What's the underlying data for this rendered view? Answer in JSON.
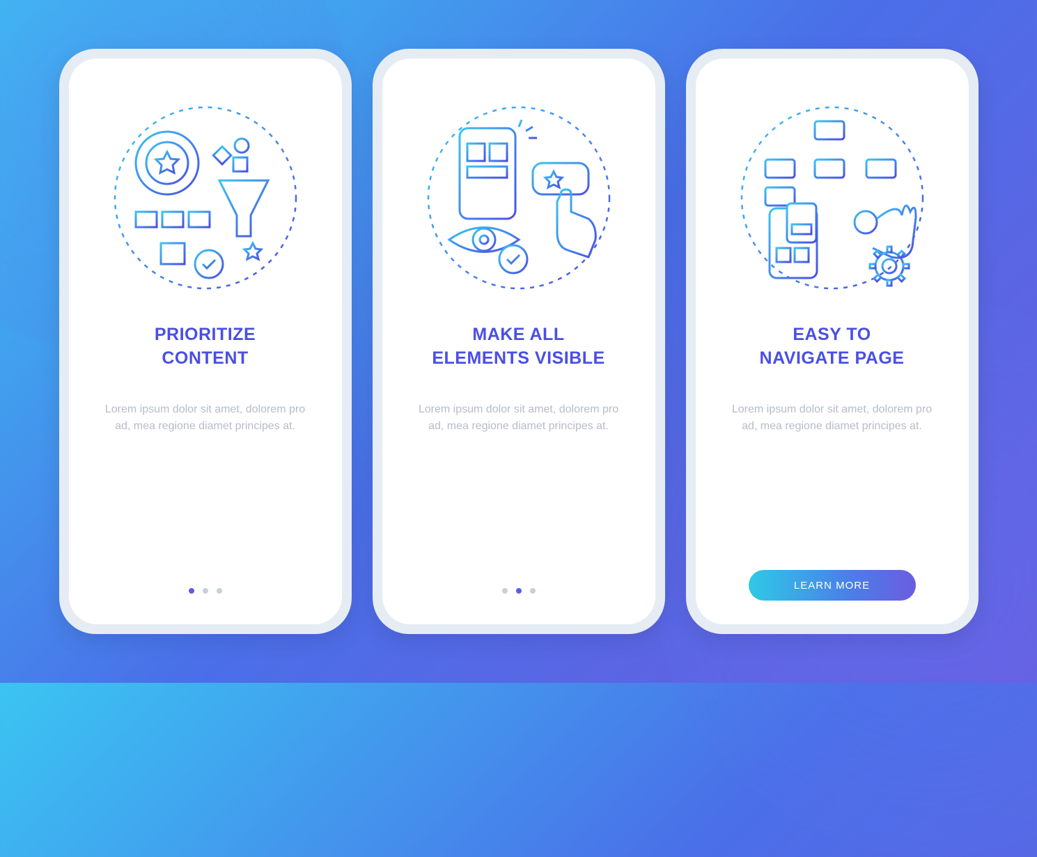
{
  "screens": [
    {
      "title": "PRIORITIZE\nCONTENT",
      "body": "Lorem ipsum dolor sit amet, dolorem pro ad, mea regione diamet principes at.",
      "indicator": {
        "total": 3,
        "active": 0
      },
      "cta": null
    },
    {
      "title": "MAKE ALL\nELEMENTS VISIBLE",
      "body": "Lorem ipsum dolor sit amet, dolorem pro ad, mea regione diamet principes at.",
      "indicator": {
        "total": 3,
        "active": 1
      },
      "cta": null
    },
    {
      "title": "EASY TO\nNAVIGATE PAGE",
      "body": "Lorem ipsum dolor sit amet, dolorem pro ad, mea regione diamet principes at.",
      "indicator": null,
      "cta": "LEARN MORE"
    }
  ],
  "colors": {
    "heading": "#4A4FE4",
    "body": "#B5BCC9",
    "dot_inactive": "#C9CFDA",
    "dot_active": "#5B5CE2",
    "stroke_light": "#3BC4F2",
    "stroke_dark": "#4A4FE4"
  }
}
